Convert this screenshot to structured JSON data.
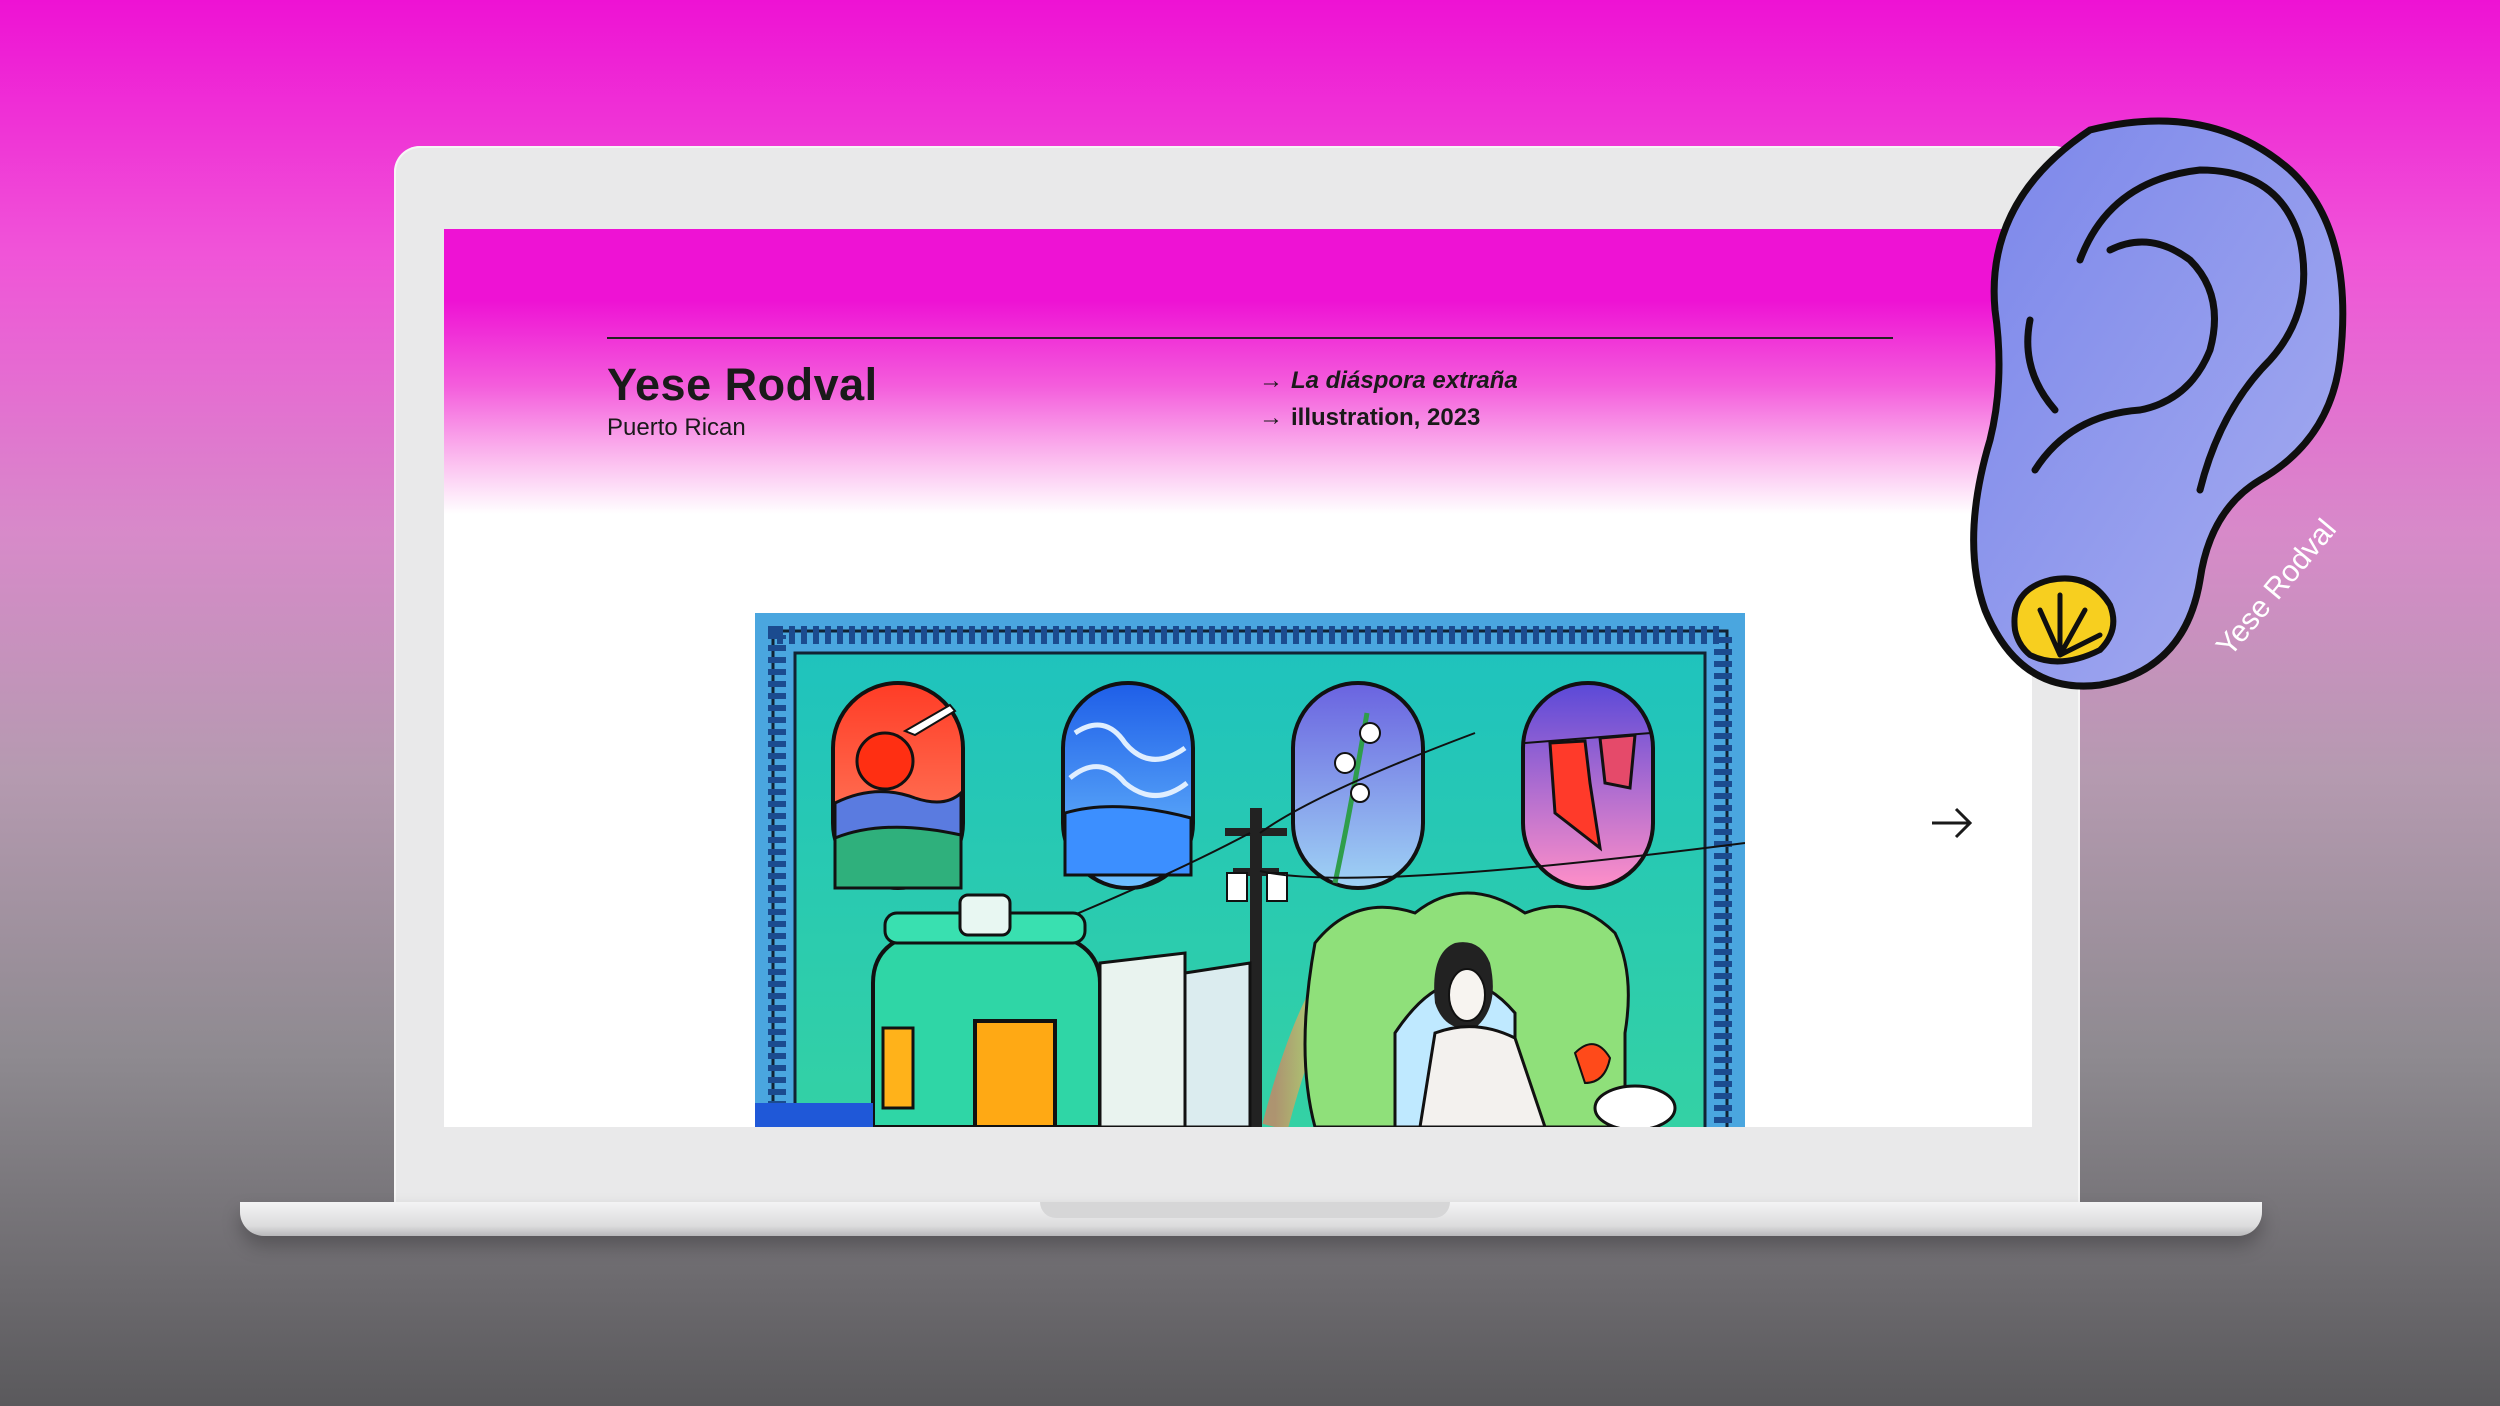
{
  "artist": {
    "name": "Yese Rodval",
    "origin": "Puerto Rican"
  },
  "work": {
    "title": "La diáspora extraña",
    "type_year": "illustration, 2023"
  },
  "sticker": {
    "label": "Yese Rodval"
  },
  "icons": {
    "meta_arrow": "→",
    "next": "arrow-right-icon"
  },
  "colors": {
    "brand_magenta": "#ee12d4",
    "ear_purple": "#8f98ee",
    "shell_yellow": "#f7cf1f",
    "art_teal": "#2ec4b0",
    "art_blue": "#4aa6df"
  }
}
